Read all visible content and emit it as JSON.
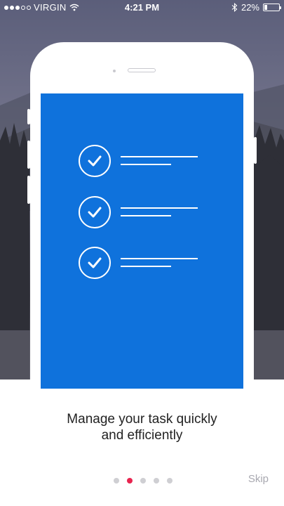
{
  "status_bar": {
    "carrier": "VIRGIN",
    "time": "4:21 PM",
    "battery_text": "22%",
    "battery_level": 0.22,
    "signal_bars_filled": 3,
    "signal_bars_total": 5,
    "icons": [
      "wifi-icon",
      "bluetooth-icon",
      "battery-icon"
    ]
  },
  "onboarding": {
    "tagline_line1": "Manage your task quickly",
    "tagline_line2": "and efficiently",
    "checklist_items": 3,
    "page_count": 5,
    "active_page": 2,
    "skip_label": "Skip"
  },
  "colors": {
    "screen_blue": "#0f72dc",
    "pager_active": "#e8244f",
    "pager_inactive": "#cfcfd3",
    "skip_text": "#a8a8b0"
  }
}
